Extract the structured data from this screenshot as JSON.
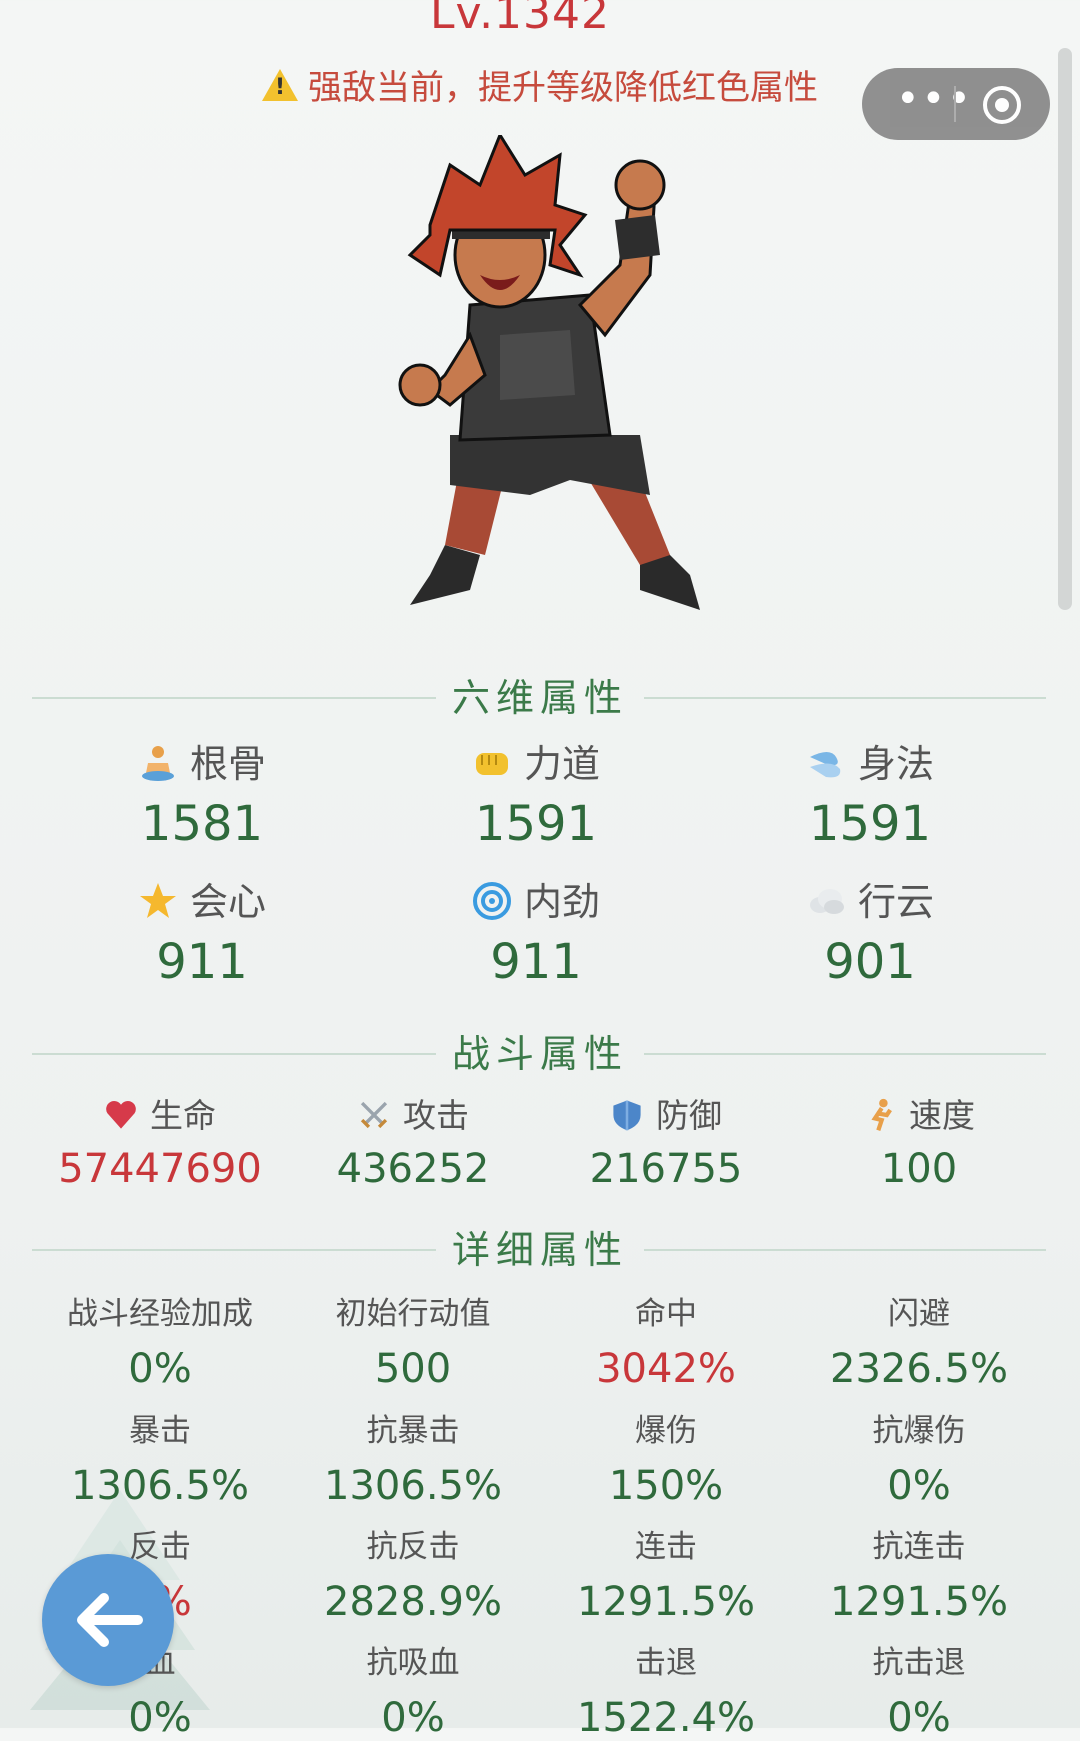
{
  "header": {
    "level": "Lv.1342",
    "warning": "强敌当前，提升等级降低红色属性"
  },
  "sections": {
    "six": "六维属性",
    "battle": "战斗属性",
    "detail": "详细属性"
  },
  "six_attrs": [
    {
      "icon": "meditation-icon",
      "label": "根骨",
      "value": "1581"
    },
    {
      "icon": "fist-icon",
      "label": "力道",
      "value": "1591"
    },
    {
      "icon": "wind-icon",
      "label": "身法",
      "value": "1591"
    },
    {
      "icon": "star-icon",
      "label": "会心",
      "value": "911"
    },
    {
      "icon": "swirl-icon",
      "label": "内劲",
      "value": "911"
    },
    {
      "icon": "cloud-icon",
      "label": "行云",
      "value": "901"
    }
  ],
  "battle_attrs": [
    {
      "icon": "heart-icon",
      "label": "生命",
      "value": "57447690",
      "color": "#c8373a"
    },
    {
      "icon": "crossed-swords-icon",
      "label": "攻击",
      "value": "436252"
    },
    {
      "icon": "shield-icon",
      "label": "防御",
      "value": "216755"
    },
    {
      "icon": "runner-icon",
      "label": "速度",
      "value": "100"
    }
  ],
  "detail_attrs": [
    {
      "label": "战斗经验加成",
      "value": "0%"
    },
    {
      "label": "初始行动值",
      "value": "500"
    },
    {
      "label": "命中",
      "value": "3042%",
      "color": "#c8373a"
    },
    {
      "label": "闪避",
      "value": "2326.5%"
    },
    {
      "label": "暴击",
      "value": "1306.5%"
    },
    {
      "label": "抗暴击",
      "value": "1306.5%"
    },
    {
      "label": "爆伤",
      "value": "150%"
    },
    {
      "label": "抗爆伤",
      "value": "0%"
    },
    {
      "label": "反击",
      "value": "2%",
      "color": "#c8373a"
    },
    {
      "label": "抗反击",
      "value": "2828.9%"
    },
    {
      "label": "连击",
      "value": "1291.5%"
    },
    {
      "label": "抗连击",
      "value": "1291.5%"
    },
    {
      "label": "血",
      "value": "0%"
    },
    {
      "label": "抗吸血",
      "value": "0%"
    },
    {
      "label": "击退",
      "value": "1522.4%"
    },
    {
      "label": "抗击退",
      "value": "0%"
    }
  ],
  "colors": {
    "accent_green": "#2f6a3c",
    "alert_red": "#c8373a",
    "back_button": "#5a9ad6"
  }
}
